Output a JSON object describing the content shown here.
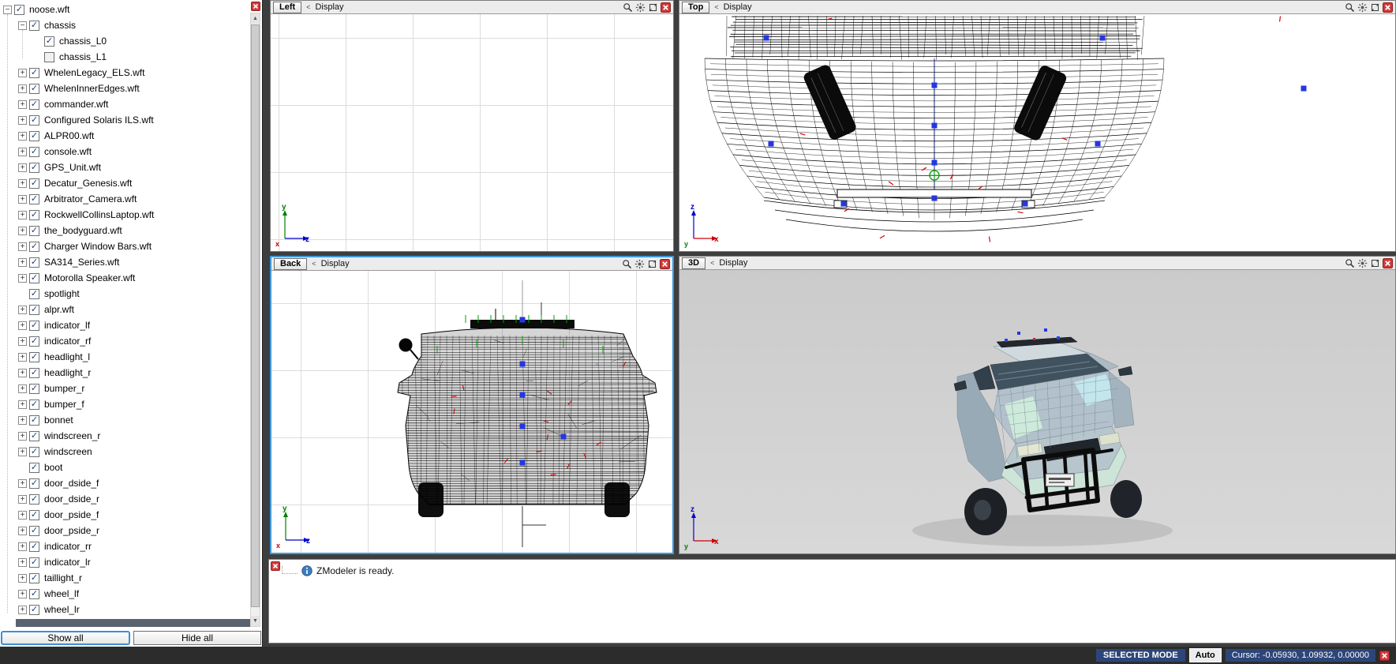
{
  "ui": {
    "display_label": "Display",
    "menu_arrow": "<"
  },
  "sidebar": {
    "tree": [
      {
        "label": "noose.wft",
        "level": 0,
        "exp": "minus",
        "checked": true
      },
      {
        "label": "chassis",
        "level": 1,
        "exp": "minus",
        "checked": true
      },
      {
        "label": "chassis_L0",
        "level": 2,
        "exp": "none",
        "checked": true
      },
      {
        "label": "chassis_L1",
        "level": 2,
        "exp": "none",
        "checked": false
      },
      {
        "label": "WhelenLegacy_ELS.wft",
        "level": 1,
        "exp": "plus",
        "checked": true
      },
      {
        "label": "WhelenInnerEdges.wft",
        "level": 1,
        "exp": "plus",
        "checked": true
      },
      {
        "label": "commander.wft",
        "level": 1,
        "exp": "plus",
        "checked": true
      },
      {
        "label": "Configured Solaris ILS.wft",
        "level": 1,
        "exp": "plus",
        "checked": true
      },
      {
        "label": "ALPR00.wft",
        "level": 1,
        "exp": "plus",
        "checked": true
      },
      {
        "label": "console.wft",
        "level": 1,
        "exp": "plus",
        "checked": true
      },
      {
        "label": "GPS_Unit.wft",
        "level": 1,
        "exp": "plus",
        "checked": true
      },
      {
        "label": "Decatur_Genesis.wft",
        "level": 1,
        "exp": "plus",
        "checked": true
      },
      {
        "label": "Arbitrator_Camera.wft",
        "level": 1,
        "exp": "plus",
        "checked": true
      },
      {
        "label": "RockwellCollinsLaptop.wft",
        "level": 1,
        "exp": "plus",
        "checked": true
      },
      {
        "label": "the_bodyguard.wft",
        "level": 1,
        "exp": "plus",
        "checked": true
      },
      {
        "label": "Charger Window Bars.wft",
        "level": 1,
        "exp": "plus",
        "checked": true
      },
      {
        "label": "SA314_Series.wft",
        "level": 1,
        "exp": "plus",
        "checked": true
      },
      {
        "label": "Motorolla Speaker.wft",
        "level": 1,
        "exp": "plus",
        "checked": true
      },
      {
        "label": "spotlight",
        "level": 1,
        "exp": "none",
        "checked": true
      },
      {
        "label": "alpr.wft",
        "level": 1,
        "exp": "plus",
        "checked": true
      },
      {
        "label": "indicator_lf",
        "level": 1,
        "exp": "plus",
        "checked": true
      },
      {
        "label": "indicator_rf",
        "level": 1,
        "exp": "plus",
        "checked": true
      },
      {
        "label": "headlight_l",
        "level": 1,
        "exp": "plus",
        "checked": true
      },
      {
        "label": "headlight_r",
        "level": 1,
        "exp": "plus",
        "checked": true
      },
      {
        "label": "bumper_r",
        "level": 1,
        "exp": "plus",
        "checked": true
      },
      {
        "label": "bumper_f",
        "level": 1,
        "exp": "plus",
        "checked": true
      },
      {
        "label": "bonnet",
        "level": 1,
        "exp": "plus",
        "checked": true
      },
      {
        "label": "windscreen_r",
        "level": 1,
        "exp": "plus",
        "checked": true
      },
      {
        "label": "windscreen",
        "level": 1,
        "exp": "plus",
        "checked": true
      },
      {
        "label": "boot",
        "level": 1,
        "exp": "none",
        "checked": true
      },
      {
        "label": "door_dside_f",
        "level": 1,
        "exp": "plus",
        "checked": true
      },
      {
        "label": "door_dside_r",
        "level": 1,
        "exp": "plus",
        "checked": true
      },
      {
        "label": "door_pside_f",
        "level": 1,
        "exp": "plus",
        "checked": true
      },
      {
        "label": "door_pside_r",
        "level": 1,
        "exp": "plus",
        "checked": true
      },
      {
        "label": "indicator_rr",
        "level": 1,
        "exp": "plus",
        "checked": true
      },
      {
        "label": "indicator_lr",
        "level": 1,
        "exp": "plus",
        "checked": true
      },
      {
        "label": "taillight_r",
        "level": 1,
        "exp": "plus",
        "checked": true
      },
      {
        "label": "wheel_lf",
        "level": 1,
        "exp": "plus",
        "checked": true
      },
      {
        "label": "wheel_lr",
        "level": 1,
        "exp": "plus",
        "checked": true
      }
    ],
    "buttons": {
      "show_all": "Show all",
      "hide_all": "Hide all"
    }
  },
  "viewports": {
    "left": {
      "name": "Left",
      "axes": {
        "up": {
          "label": "y",
          "color": "#008000"
        },
        "right": {
          "label": "z",
          "color": "#0000cc"
        },
        "origin": {
          "label": "x",
          "color": "#cc0000"
        }
      }
    },
    "top": {
      "name": "Top",
      "axes": {
        "up": {
          "label": "z",
          "color": "#0000cc"
        },
        "right": {
          "label": "x",
          "color": "#cc0000"
        },
        "origin": {
          "label": "y",
          "color": "#008000"
        }
      }
    },
    "back": {
      "name": "Back",
      "axes": {
        "up": {
          "label": "y",
          "color": "#008000"
        },
        "right": {
          "label": "z",
          "color": "#0000cc"
        },
        "origin": {
          "label": "x",
          "color": "#cc0000"
        }
      }
    },
    "threed": {
      "name": "3D",
      "axes": {
        "up": {
          "label": "z",
          "color": "#0000cc"
        },
        "right": {
          "label": "x",
          "color": "#cc0000"
        },
        "origin": {
          "label": "y",
          "color": "#008000"
        }
      }
    }
  },
  "log": {
    "message": "ZModeler is ready."
  },
  "statusbar": {
    "mode": "SELECTED MODE",
    "auto_label": "Auto",
    "cursor": "Cursor: -0.05930, 1.09932, 0.00000"
  },
  "colors": {
    "selection_blue": "#2437e0",
    "tick_red": "#d40000",
    "pivot_green": "#00a000",
    "active_viewport_border": "#3c9ade"
  }
}
